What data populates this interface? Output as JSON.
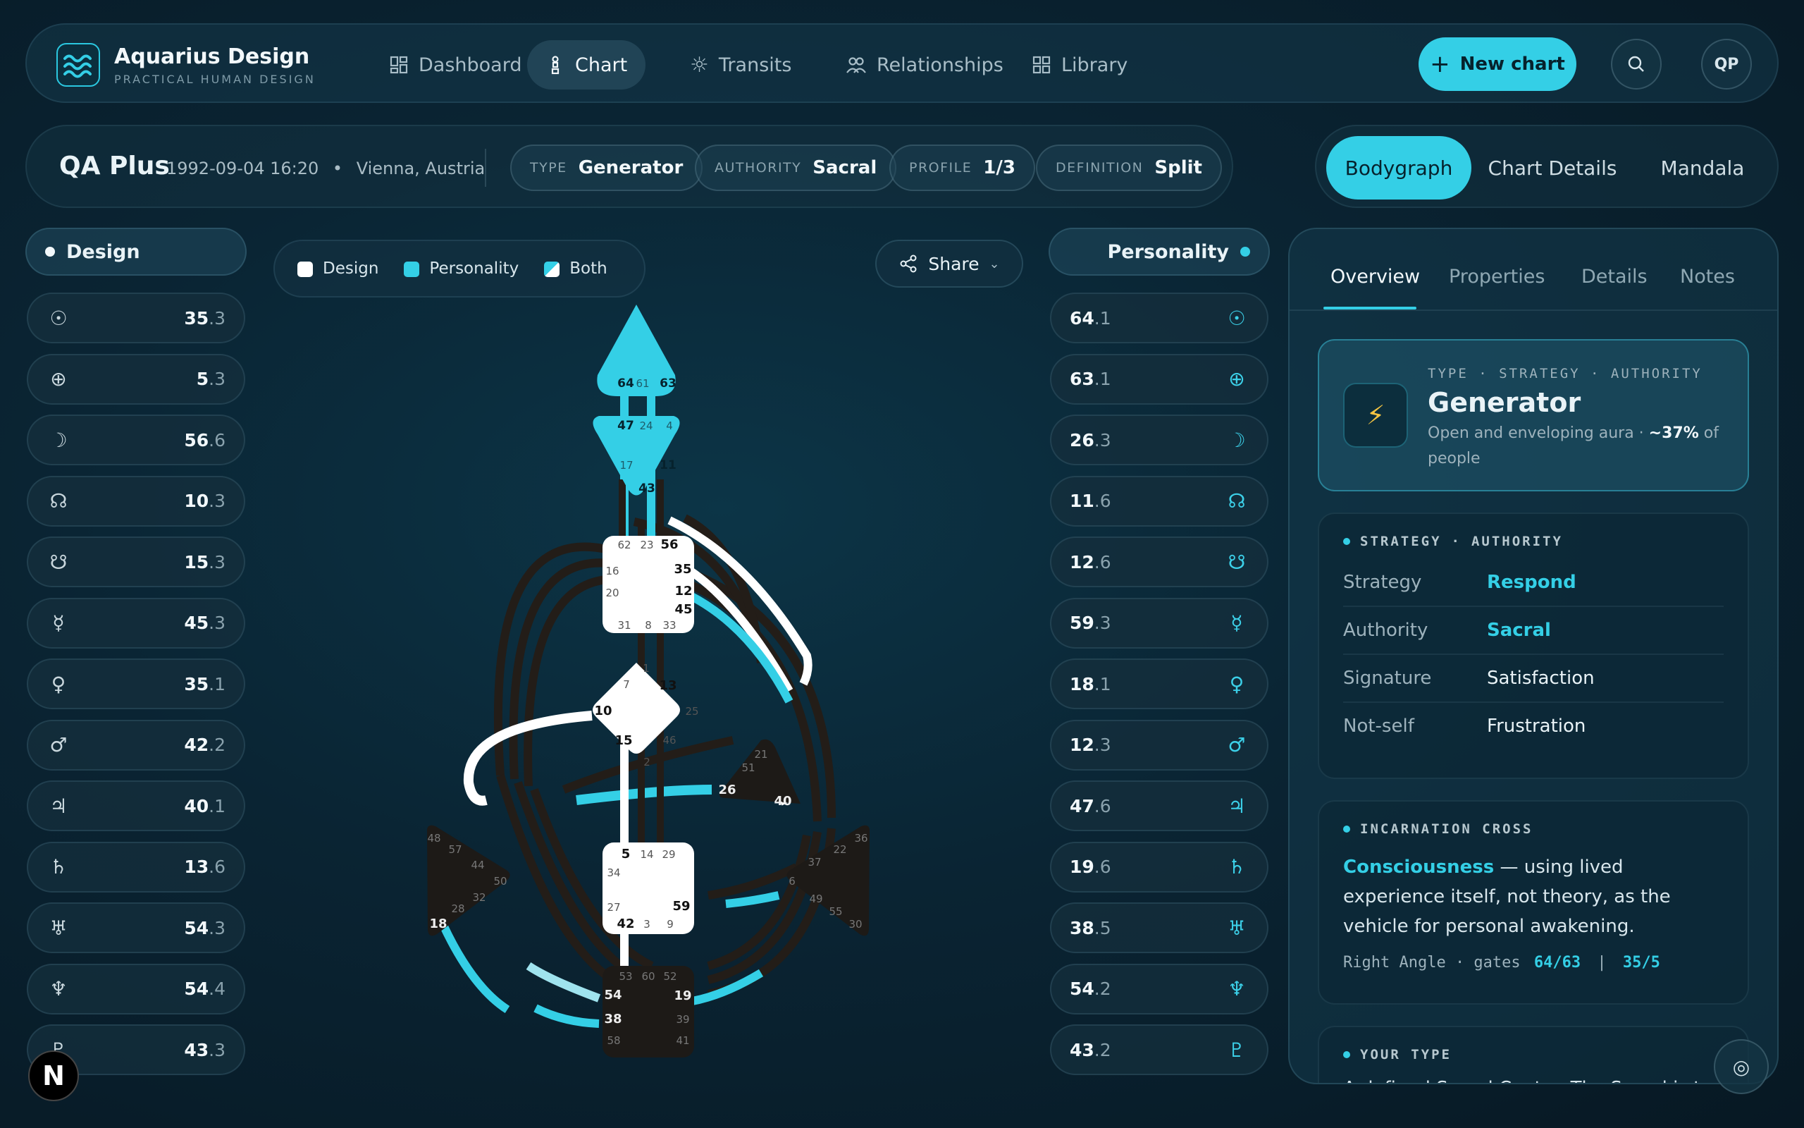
{
  "nav": {
    "brand": "Aquarius Design",
    "brand_sub": "PRACTICAL HUMAN DESIGN",
    "items": [
      {
        "label": "Dashboard",
        "icon": "dashboard-icon"
      },
      {
        "label": "Chart",
        "icon": "chart-icon",
        "active": true
      },
      {
        "label": "Transits",
        "icon": "sun-icon"
      },
      {
        "label": "Relationships",
        "icon": "people-icon"
      },
      {
        "label": "Library",
        "icon": "grid-icon"
      }
    ],
    "new_chart": "New chart",
    "avatar": "QP"
  },
  "header": {
    "name": "QA Plus",
    "datetime": "1992-09-04 16:20",
    "location": "Vienna, Austria",
    "pills": [
      {
        "key": "TYPE",
        "value": "Generator"
      },
      {
        "key": "AUTHORITY",
        "value": "Sacral"
      },
      {
        "key": "PROFILE",
        "value": "1/3"
      },
      {
        "key": "DEFINITION",
        "value": "Split"
      }
    ]
  },
  "view_tabs": [
    "Bodygraph",
    "Chart Details",
    "Mandala"
  ],
  "design": {
    "title": "Design",
    "rows": [
      {
        "icon": "sun-icon",
        "sym": "☉",
        "gate": "35",
        "line": ".3"
      },
      {
        "icon": "earth-icon",
        "sym": "⊕",
        "gate": "5",
        "line": ".3"
      },
      {
        "icon": "moon-icon",
        "sym": "☽",
        "gate": "56",
        "line": ".6"
      },
      {
        "icon": "north-node-icon",
        "sym": "☊",
        "gate": "10",
        "line": ".3"
      },
      {
        "icon": "south-node-icon",
        "sym": "☋",
        "gate": "15",
        "line": ".3"
      },
      {
        "icon": "mercury-icon",
        "sym": "☿",
        "gate": "45",
        "line": ".3"
      },
      {
        "icon": "venus-icon",
        "sym": "♀",
        "gate": "35",
        "line": ".1"
      },
      {
        "icon": "mars-icon",
        "sym": "♂",
        "gate": "42",
        "line": ".2"
      },
      {
        "icon": "jupiter-icon",
        "sym": "♃",
        "gate": "40",
        "line": ".1"
      },
      {
        "icon": "saturn-icon",
        "sym": "♄",
        "gate": "13",
        "line": ".6"
      },
      {
        "icon": "uranus-icon",
        "sym": "♅",
        "gate": "54",
        "line": ".3"
      },
      {
        "icon": "neptune-icon",
        "sym": "♆",
        "gate": "54",
        "line": ".4"
      },
      {
        "icon": "pluto-icon",
        "sym": "♇",
        "gate": "43",
        "line": ".3"
      }
    ]
  },
  "personality": {
    "title": "Personality",
    "rows": [
      {
        "icon": "sun-icon",
        "sym": "☉",
        "gate": "64",
        "line": ".1"
      },
      {
        "icon": "earth-icon",
        "sym": "⊕",
        "gate": "63",
        "line": ".1"
      },
      {
        "icon": "moon-icon",
        "sym": "☽",
        "gate": "26",
        "line": ".3"
      },
      {
        "icon": "north-node-icon",
        "sym": "☊",
        "gate": "11",
        "line": ".6"
      },
      {
        "icon": "south-node-icon",
        "sym": "☋",
        "gate": "12",
        "line": ".6"
      },
      {
        "icon": "mercury-icon",
        "sym": "☿",
        "gate": "59",
        "line": ".3"
      },
      {
        "icon": "venus-icon",
        "sym": "♀",
        "gate": "18",
        "line": ".1"
      },
      {
        "icon": "mars-icon",
        "sym": "♂",
        "gate": "12",
        "line": ".3"
      },
      {
        "icon": "jupiter-icon",
        "sym": "♃",
        "gate": "47",
        "line": ".6"
      },
      {
        "icon": "saturn-icon",
        "sym": "♄",
        "gate": "19",
        "line": ".6"
      },
      {
        "icon": "uranus-icon",
        "sym": "♅",
        "gate": "38",
        "line": ".5"
      },
      {
        "icon": "neptune-icon",
        "sym": "♆",
        "gate": "54",
        "line": ".2"
      },
      {
        "icon": "pluto-icon",
        "sym": "♇",
        "gate": "43",
        "line": ".2"
      }
    ]
  },
  "legend": {
    "design": "Design",
    "personality": "Personality",
    "both": "Both"
  },
  "share": "Share",
  "colors": {
    "accent": "#34cfe6",
    "design": "#ffffff",
    "undefined": "#1d1a17"
  },
  "bodygraph": {
    "head_gates": [
      "64",
      "61",
      "63"
    ],
    "ajna_gates": [
      "47",
      "24",
      "4",
      "17",
      "11",
      "43"
    ],
    "throat_gates": [
      "62",
      "23",
      "56",
      "16",
      "35",
      "20",
      "12",
      "45",
      "31",
      "8",
      "33"
    ],
    "g_gates": [
      "1",
      "7",
      "13",
      "10",
      "25",
      "15",
      "46",
      "2"
    ],
    "heart_gates": [
      "21",
      "51",
      "26",
      "40"
    ],
    "sacral_gates": [
      "5",
      "14",
      "29",
      "34",
      "27",
      "59",
      "42",
      "3",
      "9"
    ],
    "spleen_gates": [
      "48",
      "57",
      "44",
      "50",
      "28",
      "32",
      "18"
    ],
    "solar_gates": [
      "36",
      "22",
      "37",
      "6",
      "49",
      "55",
      "30"
    ],
    "root_gates": [
      "53",
      "60",
      "52",
      "54",
      "19",
      "38",
      "39",
      "58",
      "41"
    ]
  },
  "panel": {
    "tabs": [
      "Overview",
      "Properties",
      "Details",
      "Notes"
    ],
    "type_card": {
      "kicker": "TYPE · STRATEGY · AUTHORITY",
      "title": "Generator",
      "desc_a": "Open and enveloping aura · ",
      "desc_b": "~37%",
      "desc_c": " of people"
    },
    "strategy": {
      "kicker_a": "STRATEGY",
      "kicker_b": "AUTHORITY",
      "rows": [
        {
          "k": "Strategy",
          "v": "Respond"
        },
        {
          "k": "Authority",
          "v": "Sacral"
        },
        {
          "k": "Signature",
          "v": "Satisfaction"
        },
        {
          "k": "Not-self",
          "v": "Frustration"
        }
      ]
    },
    "cross": {
      "kicker": "INCARNATION CROSS",
      "title": "Consciousness",
      "text": " — using lived experience itself, not theory, as the vehicle for personal awakening.",
      "angle": "Right Angle · gates",
      "gates_a": "64/63",
      "sep": "|",
      "gates_b": "35/5"
    },
    "your_type": {
      "kicker": "YOUR TYPE",
      "text": "A defined Sacral Center. The Sacral is t..."
    }
  }
}
